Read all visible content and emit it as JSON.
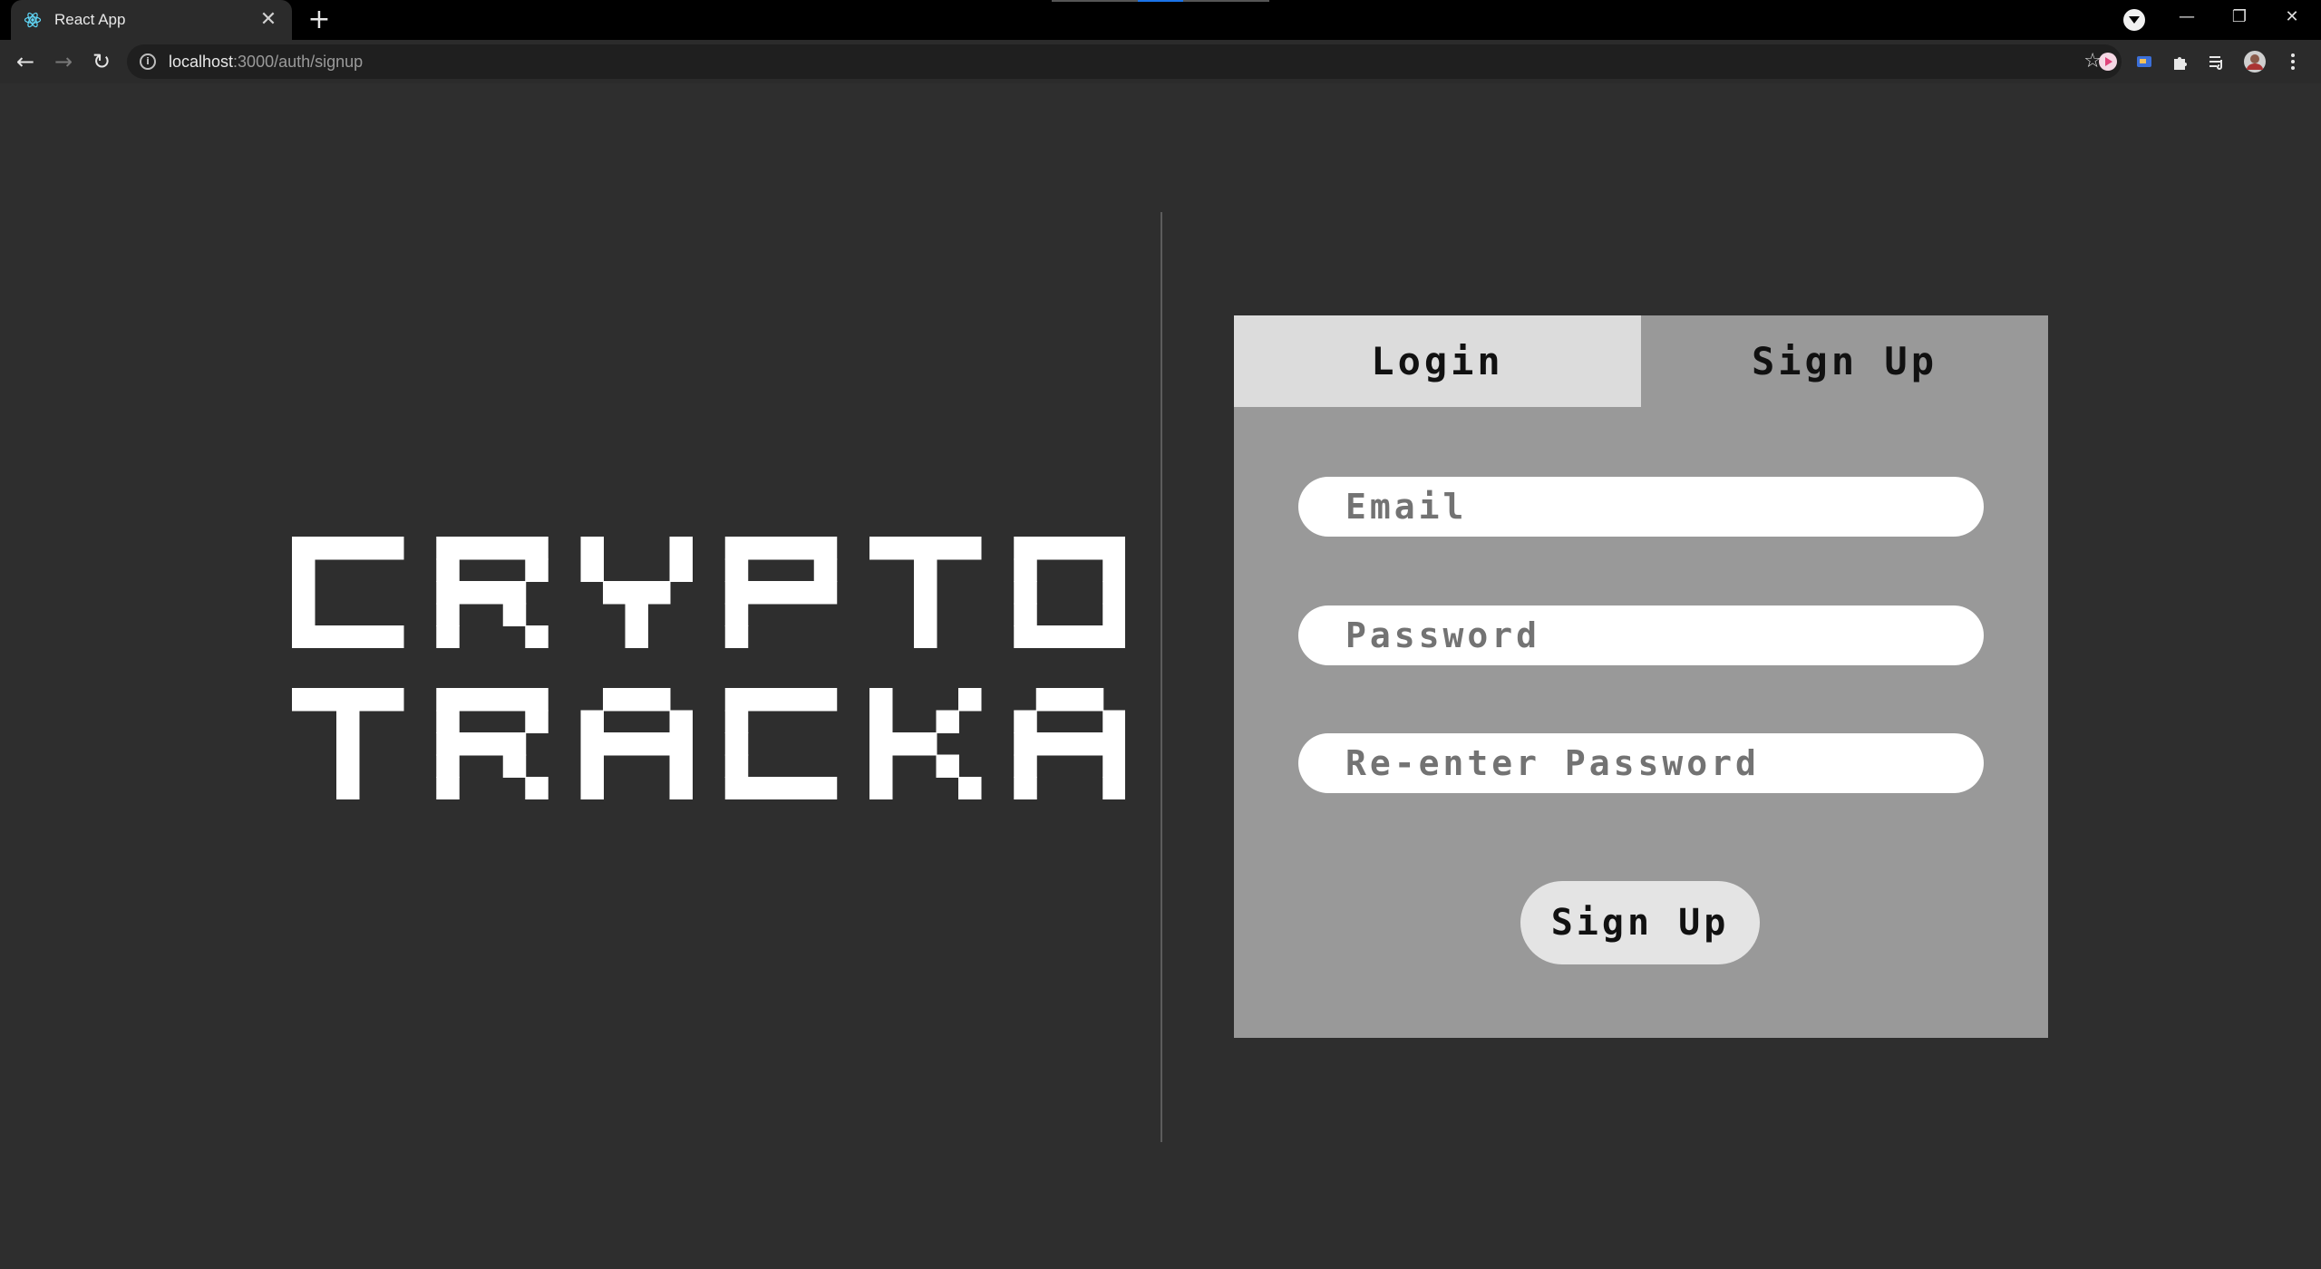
{
  "browser": {
    "tab_title": "React App",
    "tab_close": "✕",
    "new_tab": "+",
    "url_host": "localhost",
    "url_path": ":3000/auth/signup",
    "back": "←",
    "forward": "→",
    "reload": "↻",
    "star": "☆",
    "window_minimize": "—",
    "window_restore": "❐",
    "window_close": "✕",
    "extensions": [
      "profile-extension-icon",
      "cast-extension-icon",
      "puzzle-icon",
      "media-queue-icon",
      "profile-avatar"
    ]
  },
  "app": {
    "logo_line1": "CRYPTO",
    "logo_line2": "TRACKA",
    "tabs": {
      "login": "Login",
      "signup": "Sign Up"
    },
    "fields": {
      "email": "Email",
      "password": "Password",
      "reenter": "Re-enter Password"
    },
    "submit_label": "Sign Up"
  }
}
